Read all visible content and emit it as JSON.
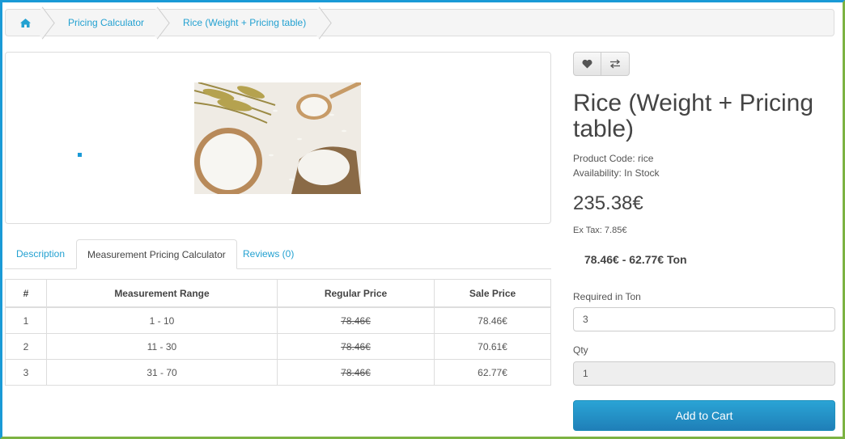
{
  "breadcrumb": {
    "home_icon": "home-icon",
    "items": [
      "Pricing Calculator",
      "Rice (Weight + Pricing table)"
    ]
  },
  "product": {
    "title": "Rice (Weight + Pricing table)",
    "code": "Product Code: rice",
    "availability": "Availability: In Stock",
    "price": "235.38€",
    "ex_tax": "Ex Tax: 7.85€",
    "price_range": "78.46€ - 62.77€ Ton"
  },
  "actions": {
    "wishlist_icon": "heart-icon",
    "compare_icon": "compare-arrows-icon"
  },
  "tabs": {
    "description": "Description",
    "calculator": "Measurement Pricing Calculator",
    "reviews": "Reviews (0)"
  },
  "pricing_table": {
    "headers": [
      "#",
      "Measurement Range",
      "Regular Price",
      "Sale Price"
    ],
    "rows": [
      [
        "1",
        "1 - 10",
        "78.46€",
        "78.46€"
      ],
      [
        "2",
        "11 - 30",
        "78.46€",
        "70.61€"
      ],
      [
        "3",
        "31 - 70",
        "78.46€",
        "62.77€"
      ]
    ]
  },
  "form": {
    "required_label": "Required in Ton",
    "required_value": "3",
    "qty_label": "Qty",
    "qty_value": "1",
    "add_to_cart": "Add to Cart"
  },
  "colors": {
    "link": "#23a1d1",
    "cart_button": "#2391c7",
    "frame_left": "#1a9ad6",
    "frame_right": "#7cb342"
  }
}
